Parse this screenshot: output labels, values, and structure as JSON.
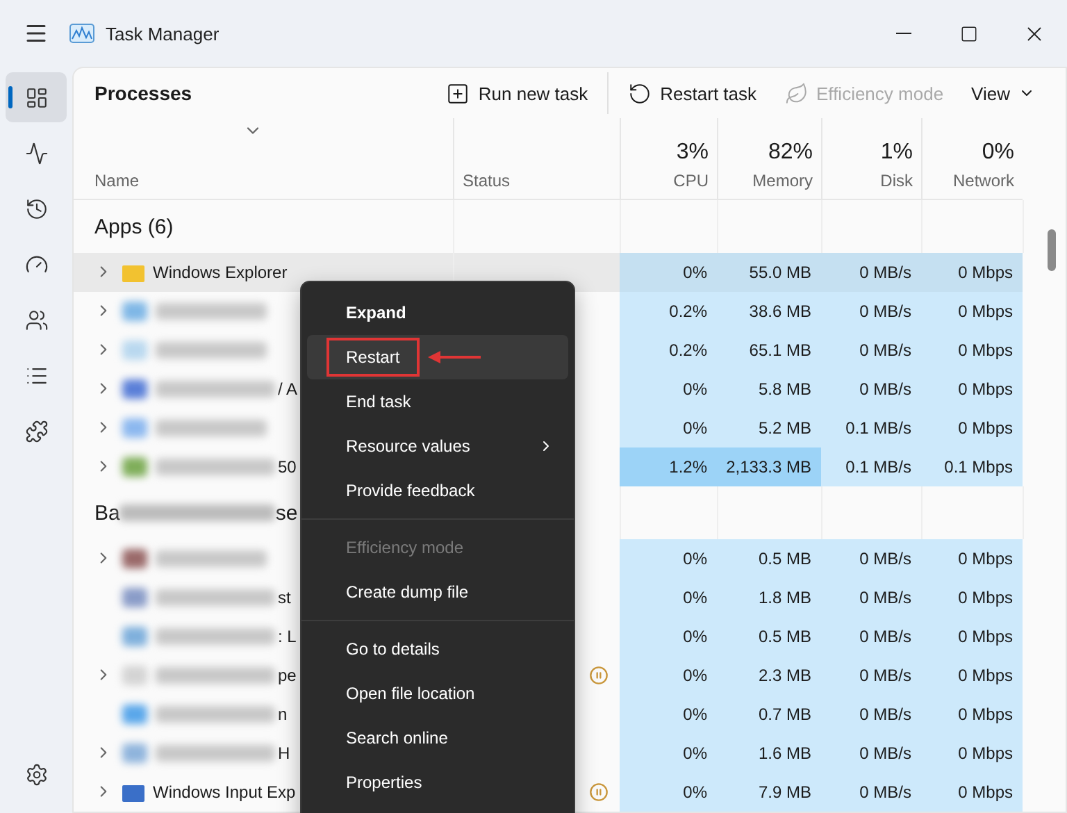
{
  "window": {
    "title": "Task Manager"
  },
  "nav": [
    {
      "kind": "processes",
      "selected": true
    },
    {
      "kind": "performance",
      "selected": false
    },
    {
      "kind": "history",
      "selected": false
    },
    {
      "kind": "startup",
      "selected": false
    },
    {
      "kind": "users",
      "selected": false
    },
    {
      "kind": "details",
      "selected": false
    },
    {
      "kind": "services",
      "selected": false
    }
  ],
  "toolbar": {
    "title": "Processes",
    "actions": [
      {
        "kind": "run",
        "label": "Run new task",
        "disabled": false
      },
      {
        "kind": "restart",
        "label": "Restart task",
        "disabled": false
      },
      {
        "kind": "efficiency",
        "label": "Efficiency mode",
        "disabled": true
      },
      {
        "kind": "view",
        "label": "View",
        "disabled": false
      }
    ]
  },
  "columns": [
    {
      "label": "Name"
    },
    {
      "label": "Status"
    },
    {
      "label": "CPU",
      "value": "3%"
    },
    {
      "label": "Memory",
      "value": "82%"
    },
    {
      "label": "Disk",
      "value": "1%"
    },
    {
      "label": "Network",
      "value": "0%"
    }
  ],
  "groups": [
    {
      "label": "Apps (6)",
      "rows": [
        {
          "name": "Windows Explorer",
          "expandable": true,
          "selected": true,
          "paused": false,
          "color": "#f2c230",
          "cells": [
            {
              "text": "0%",
              "hot": false
            },
            {
              "text": "55.0 MB",
              "hot": false
            },
            {
              "text": "0 MB/s",
              "hot": false
            },
            {
              "text": "0 Mbps",
              "hot": false
            }
          ]
        },
        {
          "expandable": true,
          "selected": false,
          "paused": false,
          "color": "#7fb7e6",
          "cells": [
            {
              "text": "0.2%",
              "hot": false
            },
            {
              "text": "38.6 MB",
              "hot": false
            },
            {
              "text": "0 MB/s",
              "hot": false
            },
            {
              "text": "0 Mbps",
              "hot": false
            }
          ]
        },
        {
          "expandable": true,
          "selected": false,
          "paused": false,
          "color": "#b9d8ef",
          "cells": [
            {
              "text": "0.2%",
              "hot": false
            },
            {
              "text": "65.1 MB",
              "hot": false
            },
            {
              "text": "0 MB/s",
              "hot": false
            },
            {
              "text": "0 Mbps",
              "hot": false
            }
          ]
        },
        {
          "tail": "/ A",
          "expandable": true,
          "selected": false,
          "paused": false,
          "color": "#5a7fd8",
          "cells": [
            {
              "text": "0%",
              "hot": false
            },
            {
              "text": "5.8 MB",
              "hot": false
            },
            {
              "text": "0 MB/s",
              "hot": false
            },
            {
              "text": "0 Mbps",
              "hot": false
            }
          ]
        },
        {
          "expandable": true,
          "selected": false,
          "paused": false,
          "color": "#8cb8ef",
          "cells": [
            {
              "text": "0%",
              "hot": false
            },
            {
              "text": "5.2 MB",
              "hot": false
            },
            {
              "text": "0.1 MB/s",
              "hot": false
            },
            {
              "text": "0 Mbps",
              "hot": false
            }
          ]
        },
        {
          "tail": "50",
          "expandable": true,
          "selected": false,
          "paused": false,
          "color": "#7fae5a",
          "cells": [
            {
              "text": "1.2%",
              "hot": true
            },
            {
              "text": "2,133.3 MB",
              "hot": true
            },
            {
              "text": "0.1 MB/s",
              "hot": false
            },
            {
              "text": "0.1 Mbps",
              "hot": false
            }
          ]
        }
      ]
    },
    {
      "label_fragments": [
        "Ba",
        "se"
      ],
      "rows": [
        {
          "expandable": true,
          "selected": false,
          "paused": false,
          "color": "#9a6a6a",
          "cells": [
            {
              "text": "0%",
              "hot": false
            },
            {
              "text": "0.5 MB",
              "hot": false
            },
            {
              "text": "0 MB/s",
              "hot": false
            },
            {
              "text": "0 Mbps",
              "hot": false
            }
          ]
        },
        {
          "tail": "st",
          "expandable": false,
          "selected": false,
          "paused": false,
          "color": "#8a9cc8",
          "cells": [
            {
              "text": "0%",
              "hot": false
            },
            {
              "text": "1.8 MB",
              "hot": false
            },
            {
              "text": "0 MB/s",
              "hot": false
            },
            {
              "text": "0 Mbps",
              "hot": false
            }
          ]
        },
        {
          "tail": ": L",
          "expandable": false,
          "selected": false,
          "paused": false,
          "color": "#7fb0dc",
          "cells": [
            {
              "text": "0%",
              "hot": false
            },
            {
              "text": "0.5 MB",
              "hot": false
            },
            {
              "text": "0 MB/s",
              "hot": false
            },
            {
              "text": "0 Mbps",
              "hot": false
            }
          ]
        },
        {
          "tail": "pe",
          "expandable": true,
          "selected": false,
          "paused": true,
          "color": "#d4d4d4",
          "cells": [
            {
              "text": "0%",
              "hot": false
            },
            {
              "text": "2.3 MB",
              "hot": false
            },
            {
              "text": "0 MB/s",
              "hot": false
            },
            {
              "text": "0 Mbps",
              "hot": false
            }
          ]
        },
        {
          "tail": "n",
          "expandable": false,
          "selected": false,
          "paused": false,
          "color": "#5aa7ea",
          "cells": [
            {
              "text": "0%",
              "hot": false
            },
            {
              "text": "0.7 MB",
              "hot": false
            },
            {
              "text": "0 MB/s",
              "hot": false
            },
            {
              "text": "0 Mbps",
              "hot": false
            }
          ]
        },
        {
          "tail": "H",
          "expandable": true,
          "selected": false,
          "paused": false,
          "color": "#8fb4dc",
          "cells": [
            {
              "text": "0%",
              "hot": false
            },
            {
              "text": "1.6 MB",
              "hot": false
            },
            {
              "text": "0 MB/s",
              "hot": false
            },
            {
              "text": "0 Mbps",
              "hot": false
            }
          ]
        },
        {
          "name": "Windows Input Exp",
          "expandable": true,
          "selected": false,
          "paused": true,
          "color": "#3a6fc8",
          "cells": [
            {
              "text": "0%",
              "hot": false
            },
            {
              "text": "7.9 MB",
              "hot": false
            },
            {
              "text": "0 MB/s",
              "hot": false
            },
            {
              "text": "0 Mbps",
              "hot": false
            }
          ]
        }
      ]
    }
  ],
  "context_menu": {
    "items": [
      {
        "kind": "item",
        "label": "Expand",
        "bold": true,
        "selected": false,
        "disabled": false,
        "submenu": false,
        "annotated": false
      },
      {
        "kind": "item",
        "label": "Restart",
        "bold": false,
        "selected": true,
        "disabled": false,
        "submenu": false,
        "annotated": true
      },
      {
        "kind": "item",
        "label": "End task",
        "bold": false,
        "selected": false,
        "disabled": false,
        "submenu": false,
        "annotated": false
      },
      {
        "kind": "item",
        "label": "Resource values",
        "bold": false,
        "selected": false,
        "disabled": false,
        "submenu": true,
        "annotated": false
      },
      {
        "kind": "item",
        "label": "Provide feedback",
        "bold": false,
        "selected": false,
        "disabled": false,
        "submenu": false,
        "annotated": false
      },
      {
        "kind": "separator"
      },
      {
        "kind": "item",
        "label": "Efficiency mode",
        "bold": false,
        "selected": false,
        "disabled": true,
        "submenu": false,
        "annotated": false
      },
      {
        "kind": "item",
        "label": "Create dump file",
        "bold": false,
        "selected": false,
        "disabled": false,
        "submenu": false,
        "annotated": false
      },
      {
        "kind": "separator"
      },
      {
        "kind": "item",
        "label": "Go to details",
        "bold": false,
        "selected": false,
        "disabled": false,
        "submenu": false,
        "annotated": false
      },
      {
        "kind": "item",
        "label": "Open file location",
        "bold": false,
        "selected": false,
        "disabled": false,
        "submenu": false,
        "annotated": false
      },
      {
        "kind": "item",
        "label": "Search online",
        "bold": false,
        "selected": false,
        "disabled": false,
        "submenu": false,
        "annotated": false
      },
      {
        "kind": "item",
        "label": "Properties",
        "bold": false,
        "selected": false,
        "disabled": false,
        "submenu": false,
        "annotated": false
      }
    ]
  }
}
